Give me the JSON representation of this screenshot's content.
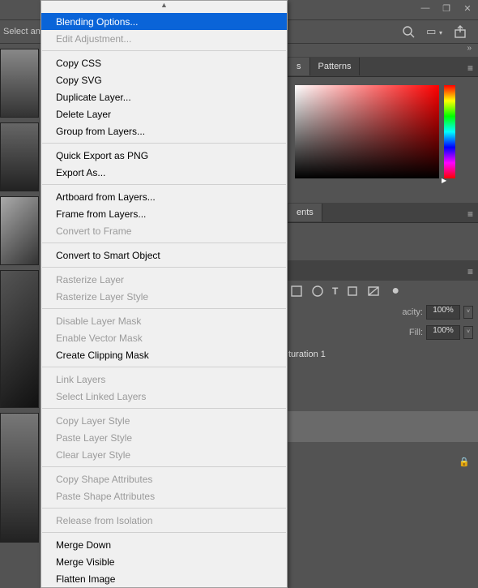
{
  "window_controls": {
    "minimize": "—",
    "maximize": "❐",
    "close": "✕"
  },
  "options_bar": {
    "left_text": "Select and"
  },
  "panels": {
    "color_tab": "s",
    "patterns_tab": "Patterns",
    "adjustments_tab": "ents"
  },
  "layers": {
    "opacity_label": "acity:",
    "opacity_value": "100%",
    "fill_label": "Fill:",
    "fill_value": "100%",
    "item1": "turation 1"
  },
  "context_menu": {
    "items": [
      {
        "label": "Blending Options...",
        "state": "highlighted"
      },
      {
        "label": "Edit Adjustment...",
        "state": "disabled"
      },
      {
        "sep": true
      },
      {
        "label": "Copy CSS"
      },
      {
        "label": "Copy SVG"
      },
      {
        "label": "Duplicate Layer..."
      },
      {
        "label": "Delete Layer"
      },
      {
        "label": "Group from Layers..."
      },
      {
        "sep": true
      },
      {
        "label": "Quick Export as PNG"
      },
      {
        "label": "Export As..."
      },
      {
        "sep": true
      },
      {
        "label": "Artboard from Layers..."
      },
      {
        "label": "Frame from Layers..."
      },
      {
        "label": "Convert to Frame",
        "state": "disabled"
      },
      {
        "sep": true
      },
      {
        "label": "Convert to Smart Object"
      },
      {
        "sep": true
      },
      {
        "label": "Rasterize Layer",
        "state": "disabled"
      },
      {
        "label": "Rasterize Layer Style",
        "state": "disabled"
      },
      {
        "sep": true
      },
      {
        "label": "Disable Layer Mask",
        "state": "disabled"
      },
      {
        "label": "Enable Vector Mask",
        "state": "disabled"
      },
      {
        "label": "Create Clipping Mask"
      },
      {
        "sep": true
      },
      {
        "label": "Link Layers",
        "state": "disabled"
      },
      {
        "label": "Select Linked Layers",
        "state": "disabled"
      },
      {
        "sep": true
      },
      {
        "label": "Copy Layer Style",
        "state": "disabled"
      },
      {
        "label": "Paste Layer Style",
        "state": "disabled"
      },
      {
        "label": "Clear Layer Style",
        "state": "disabled"
      },
      {
        "sep": true
      },
      {
        "label": "Copy Shape Attributes",
        "state": "disabled"
      },
      {
        "label": "Paste Shape Attributes",
        "state": "disabled"
      },
      {
        "sep": true
      },
      {
        "label": "Release from Isolation",
        "state": "disabled"
      },
      {
        "sep": true
      },
      {
        "label": "Merge Down"
      },
      {
        "label": "Merge Visible"
      },
      {
        "label": "Flatten Image"
      }
    ]
  }
}
